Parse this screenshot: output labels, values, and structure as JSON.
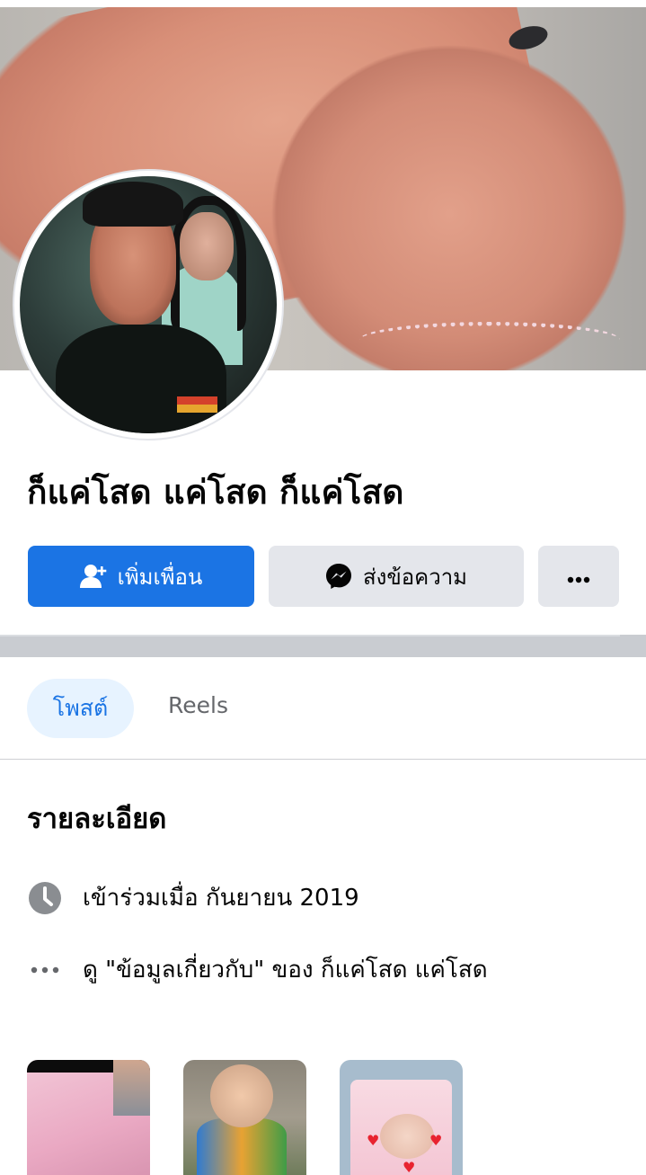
{
  "profile": {
    "name": "ก็แค่โสด แค่โสด ก็แค่โสด"
  },
  "actions": {
    "add_friend_label": "เพิ่มเพื่อน",
    "message_label": "ส่งข้อความ",
    "more_label": "···"
  },
  "tabs": [
    {
      "label": "โพสต์",
      "active": true
    },
    {
      "label": "Reels",
      "active": false
    }
  ],
  "details": {
    "title": "รายละเอียด",
    "joined": "เข้าร่วมเมื่อ กันยายน  2019",
    "about_link": "ดู \"ข้อมูลเกี่ยวกับ\" ของ ก็แค่โสด แค่โสด"
  },
  "colors": {
    "primary": "#1b74e4",
    "secondary_button": "#e4e6eb",
    "active_tab_bg": "#e7f3ff",
    "muted_text": "#65676b"
  },
  "icons": {
    "add_friend": "person-add-icon",
    "messenger": "messenger-icon",
    "more": "more-dots-icon",
    "clock": "clock-icon",
    "about": "ellipsis-icon"
  }
}
